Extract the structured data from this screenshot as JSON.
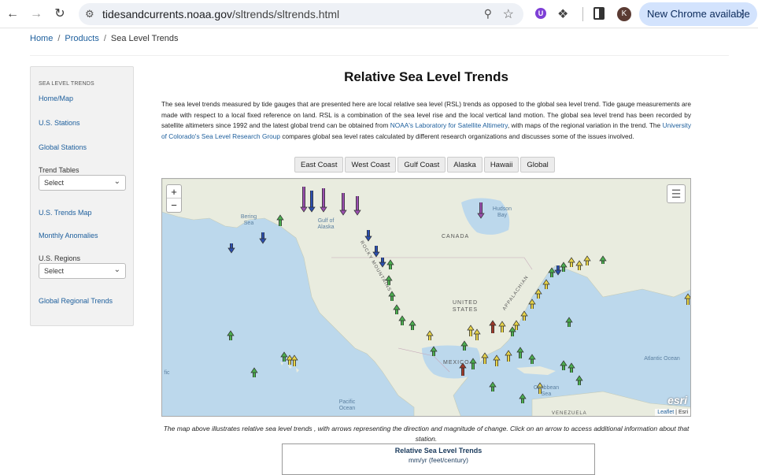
{
  "browser": {
    "url_host": "tidesandcurrents.noaa.gov",
    "url_path": "/sltrends/sltrends.html",
    "profile_initial": "K",
    "update_label": "New Chrome available"
  },
  "breadcrumb": {
    "home": "Home",
    "products": "Products",
    "current": "Sea Level Trends"
  },
  "sidebar": {
    "heading": "SEA LEVEL TRENDS",
    "home_map": "Home/Map",
    "us_stations": "U.S. Stations",
    "global_stations": "Global Stations",
    "trend_tables_label": "Trend Tables",
    "trend_tables_select": "Select",
    "us_trends_map": "U.S. Trends Map",
    "monthly_anomalies": "Monthly Anomalies",
    "us_regions_label": "U.S. Regions",
    "us_regions_select": "Select",
    "global_regional_trends": "Global Regional Trends"
  },
  "main": {
    "title": "Relative Sea Level Trends",
    "intro_1": "The sea level trends measured by tide gauges that are presented here are local relative sea level (RSL) trends as opposed to the global sea level trend. Tide gauge measurements are made with respect to a local fixed reference on land. RSL is a combination of the sea level rise and the local vertical land motion. The global sea level trend has been recorded by satellite altimeters since 1992 and the latest global trend can be obtained from ",
    "intro_link_1": "NOAA's Laboratory for Satellite Altimetry",
    "intro_2": ", with maps of the regional variation in the trend. The ",
    "intro_link_2": "University of Colorado's Sea Level Research Group",
    "intro_3": " compares global sea level rates calculated by different research organizations and discusses some of the issues involved.",
    "region_buttons": [
      "East Coast",
      "West Coast",
      "Gulf Coast",
      "Alaska",
      "Hawaii",
      "Global"
    ]
  },
  "map": {
    "zoom_in": "+",
    "zoom_out": "−",
    "labels": {
      "canada": "CANADA",
      "united_states": "UNITED STATES",
      "mexico": "MEXICO",
      "bering_sea": "Bering Sea",
      "gulf_alaska": "Gulf of Alaska",
      "hudson_bay": "Hudson Bay",
      "atlantic": "Atlantic Ocean",
      "pacific": "Pacific Ocean",
      "pacific_left": "fic",
      "caribbean": "Caribbean Sea",
      "rocky": "ROCKY MOUNTAINS",
      "appalachian": "APPALACHIAN",
      "venezuela": "VENEZUELA"
    },
    "esri": "esri",
    "attrib_leaflet": "Leaflet",
    "attrib_esri": "Esri",
    "colors": {
      "land": "#e9ecdf",
      "ocean": "#bcd8ec",
      "rise_high": "#a03a2a",
      "rise": "#e8d44a",
      "stable": "#4caf50",
      "fall": "#2b4fb0",
      "fall_high": "#9b4fb0"
    }
  },
  "caption": "The map above illustrates relative sea level trends , with arrows representing the direction and magnitude of change. Click on an arrow to access additional information about that station.",
  "legend": {
    "title": "Relative Sea Level Trends",
    "subtitle": "mm/yr (feet/century)"
  }
}
